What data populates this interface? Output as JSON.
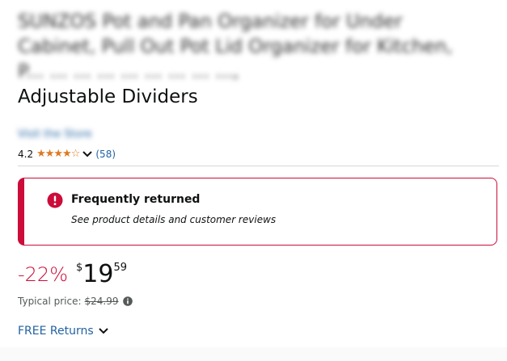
{
  "product": {
    "title_lines": [
      "SUNZOS Pot and Pan Organizer for Under",
      "Cabinet, Pull Out Pot Lid Organizer for Kitchen,",
      "P... ... ...  ... ...  ... ... ... ...,",
      "Adjustable Dividers"
    ],
    "store_link": "Visit the Store"
  },
  "rating": {
    "value": "4.2",
    "stars": 4.2,
    "stars_glyphs": "★★★★☆",
    "count": "(58)"
  },
  "alert": {
    "title": "Frequently returned",
    "subtitle": "See product details and customer reviews",
    "color": "#cc0c39"
  },
  "pricing": {
    "discount": "-22%",
    "currency_symbol": "$",
    "whole": "19",
    "fraction": "59",
    "typical_label": "Typical price:",
    "typical_value": "$24.99"
  },
  "returns": {
    "label": "FREE Returns"
  },
  "colors": {
    "link": "#2162a1",
    "star": "#de7921",
    "discount": "#cc0c39",
    "text": "#0f1111"
  }
}
